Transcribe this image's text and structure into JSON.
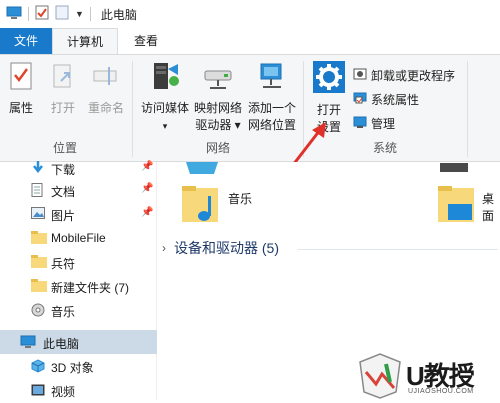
{
  "window": {
    "title": "此电脑"
  },
  "tabs": [
    {
      "label": "文件"
    },
    {
      "label": "计算机"
    },
    {
      "label": "查看"
    }
  ],
  "ribbon": {
    "location_group": {
      "label": "位置",
      "buttons": [
        {
          "label": "属性",
          "icon": "properties-icon"
        },
        {
          "label": "打开",
          "icon": "open-icon"
        },
        {
          "label": "重命名",
          "icon": "rename-icon"
        }
      ]
    },
    "network_group": {
      "label": "网络",
      "buttons": [
        {
          "line1": "访问媒体",
          "line2": "▾",
          "icon": "media-server-icon"
        },
        {
          "line1": "映射网络",
          "line2": "驱动器 ▾",
          "icon": "map-drive-icon"
        },
        {
          "line1": "添加一个",
          "line2": "网络位置",
          "icon": "network-location-icon"
        }
      ]
    },
    "system_group": {
      "label": "系统",
      "open_settings": {
        "line1": "打开",
        "line2": "设置",
        "icon": "settings-gear-icon"
      },
      "small_buttons": [
        {
          "label": "卸载或更改程序",
          "icon": "uninstall-icon"
        },
        {
          "label": "系统属性",
          "icon": "system-properties-icon"
        },
        {
          "label": "管理",
          "icon": "manage-icon"
        }
      ]
    }
  },
  "nav": {
    "items": [
      {
        "label": "下载"
      },
      {
        "label": "文档"
      },
      {
        "label": "图片"
      },
      {
        "label": "MobileFile"
      },
      {
        "label": "兵符"
      },
      {
        "label": "新建文件夹 (7)"
      },
      {
        "label": "音乐"
      },
      {
        "label": "此电脑"
      },
      {
        "label": "3D 对象"
      },
      {
        "label": "视频"
      }
    ]
  },
  "content": {
    "music_label": "音乐",
    "desktop_label": "桌面",
    "devices_header": "设备和驱动器 (5)"
  },
  "watermark": {
    "brand": "U教授",
    "url": "UJIAOSHOU.COM"
  },
  "colors": {
    "accent": "#1979ca",
    "annotation_arrow": "#e0302a"
  }
}
